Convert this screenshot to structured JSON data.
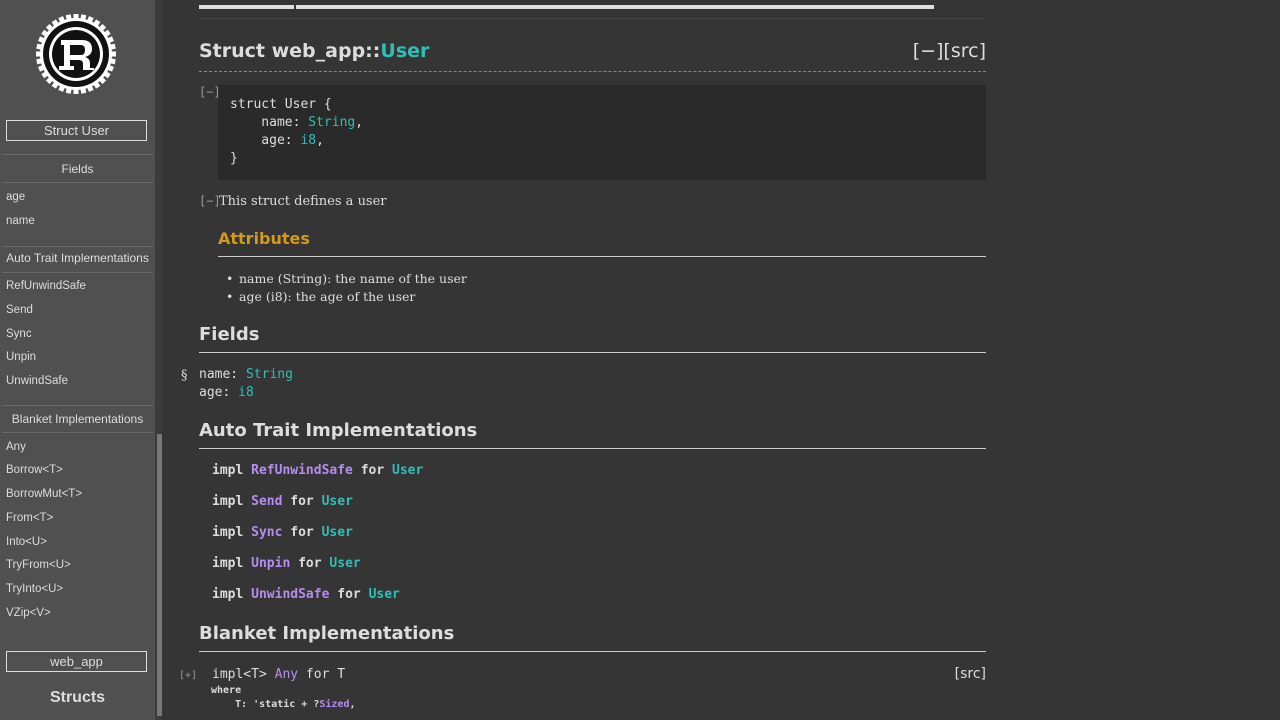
{
  "sidebar": {
    "struct_button": "Struct User",
    "fields_head": "Fields",
    "fields": [
      "age",
      "name"
    ],
    "auto_head": "Auto Trait Implementations",
    "auto_items": [
      "RefUnwindSafe",
      "Send",
      "Sync",
      "Unpin",
      "UnwindSafe"
    ],
    "blanket_head": "Blanket Implementations",
    "blanket_items": [
      "Any",
      "Borrow<T>",
      "BorrowMut<T>",
      "From<T>",
      "Into<U>",
      "TryFrom<U>",
      "TryInto<U>",
      "VZip<V>"
    ],
    "crate_button": "web_app",
    "structs_head": "Structs"
  },
  "main": {
    "title_prefix": "Struct web_app::",
    "title_name": "User",
    "title_src": "[−][src]",
    "toggle_collapse": "[−]",
    "code": {
      "line1": "struct User {",
      "field1_name": "    name: ",
      "field1_type": "String",
      "field1_end": ",",
      "field2_name": "    age: ",
      "field2_type": "i8",
      "field2_end": ",",
      "line_close": "}"
    },
    "doc_text": "This struct defines a user",
    "attributes_head": "Attributes",
    "attributes": [
      "name (String): the name of the user",
      "age (i8): the age of the user"
    ],
    "fields_head": "Fields",
    "anchor": "§",
    "fields": [
      {
        "name": "name: ",
        "type": "String"
      },
      {
        "name": "age: ",
        "type": "i8"
      }
    ],
    "auto_head": "Auto Trait Implementations",
    "auto_impls": [
      {
        "trait": "RefUnwindSafe",
        "for": "User"
      },
      {
        "trait": "Send",
        "for": "User"
      },
      {
        "trait": "Sync",
        "for": "User"
      },
      {
        "trait": "Unpin",
        "for": "User"
      },
      {
        "trait": "UnwindSafe",
        "for": "User"
      }
    ],
    "impl_kw": "impl ",
    "for_kw": " for ",
    "blanket_head": "Blanket Implementations",
    "blanket_toggle": "[+]",
    "blanket_impl": {
      "prefix": "impl<T> ",
      "trait": "Any",
      "suffix": " for T",
      "where_kw": "where",
      "bound_prefix": "    T: 'static + ?",
      "bound_trait": "Sized",
      "bound_end": ","
    },
    "src": "[src]"
  },
  "colors": {
    "background": "#353535",
    "sidebar": "#505050",
    "type": "#2dbfb8",
    "trait": "#b78cf2",
    "heading_accent": "#d2991d"
  }
}
